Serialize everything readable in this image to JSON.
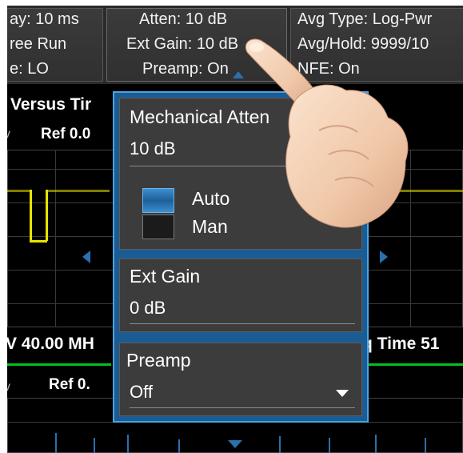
{
  "topbar": {
    "sweep_line1": "ay: 10 ms",
    "sweep_line2": "ree Run",
    "sweep_line3": "e: LO",
    "atten": "Atten: 10 dB",
    "ext_gain": "Ext Gain: 10 dB",
    "preamp": "Preamp: On",
    "avg_type": "Avg Type: Log-Pwr",
    "avg_hold": "Avg/Hold: 9999/10",
    "nfe": "NFE: On"
  },
  "upper_plot": {
    "title": "Versus Tir",
    "unit_prefix": "v",
    "ref": "Ref 0.0"
  },
  "freq_readout": {
    "left": "V 40.00 MH",
    "right": "q Time  51"
  },
  "lower_plot": {
    "unit_prefix": "v",
    "ref": "Ref 0."
  },
  "popup": {
    "mech_atten": {
      "label": "Mechanical Atten",
      "value": "10 dB",
      "mode_auto": "Auto",
      "mode_man": "Man",
      "selected_mode": "Auto"
    },
    "ext_gain": {
      "label": "Ext Gain",
      "value": "0 dB"
    },
    "preamp": {
      "label": "Preamp",
      "value": "Off"
    }
  },
  "colors": {
    "accent": "#1a5c93",
    "trace": "#e8e400",
    "panel": "#3c3c3c"
  }
}
